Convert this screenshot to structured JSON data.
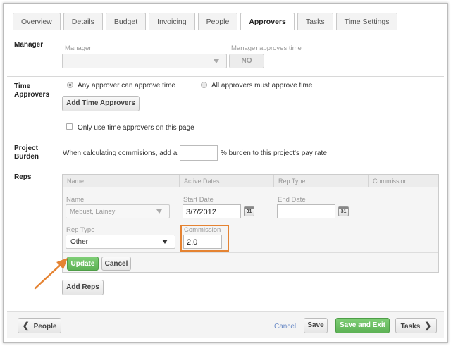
{
  "tabs": [
    {
      "label": "Overview",
      "active": false
    },
    {
      "label": "Details",
      "active": false
    },
    {
      "label": "Budget",
      "active": false
    },
    {
      "label": "Invoicing",
      "active": false
    },
    {
      "label": "People",
      "active": false
    },
    {
      "label": "Approvers",
      "active": true
    },
    {
      "label": "Tasks",
      "active": false
    },
    {
      "label": "Time Settings",
      "active": false
    }
  ],
  "manager": {
    "section_label": "Manager",
    "field_label": "Manager",
    "value": "",
    "approves_label": "Manager approves time",
    "approves_value": "NO"
  },
  "time_approvers": {
    "section_label": "Time Approvers",
    "option_any": "Any approver can approve time",
    "option_all": "All approvers must approve time",
    "selected": "any",
    "add_button": "Add Time Approvers",
    "only_page_label": "Only use time approvers on this page",
    "only_page_checked": false
  },
  "project_burden": {
    "section_label": "Project Burden",
    "prefix": "When calculating commisions, add a",
    "value": "",
    "suffix": "% burden to this project's pay rate"
  },
  "reps": {
    "section_label": "Reps",
    "columns": [
      "Name",
      "Active Dates",
      "Rep Type",
      "Commission"
    ],
    "edit_row": {
      "name_label": "Name",
      "name_value": "Mebust, Lainey",
      "start_label": "Start Date",
      "start_value": "3/7/2012",
      "end_label": "End Date",
      "end_value": "",
      "calendar_day": "31",
      "rep_type_label": "Rep Type",
      "rep_type_value": "Other",
      "commission_label": "Commission",
      "commission_value": "2.0"
    },
    "update_button": "Update",
    "cancel_button": "Cancel",
    "add_button": "Add Reps"
  },
  "footer": {
    "back_label": "People",
    "cancel_link": "Cancel",
    "save_label": "Save",
    "save_exit_label": "Save and Exit",
    "next_label": "Tasks"
  },
  "colors": {
    "accent_green": "#5db255",
    "highlight_orange": "#e58332",
    "link_blue": "#6b8bc6"
  }
}
